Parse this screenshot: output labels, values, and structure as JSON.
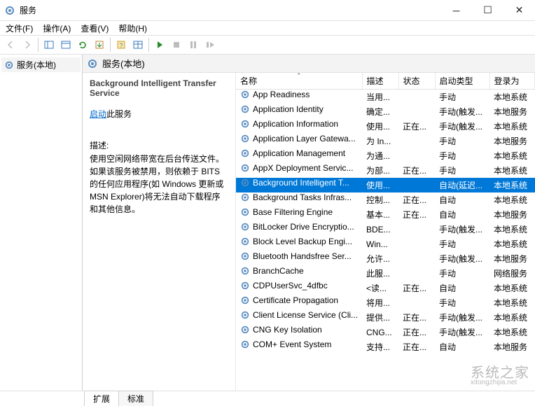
{
  "window": {
    "title": "服务"
  },
  "menubar": [
    "文件(F)",
    "操作(A)",
    "查看(V)",
    "帮助(H)"
  ],
  "tree": {
    "root": "服务(本地)"
  },
  "crumb": "服务(本地)",
  "detail": {
    "service_name": "Background Intelligent Transfer Service",
    "action_link": "启动",
    "action_suffix": "此服务",
    "desc_label": "描述:",
    "desc_text": "使用空闲网络带宽在后台传送文件。如果该服务被禁用，则依赖于 BITS 的任何应用程序(如 Windows 更新或 MSN Explorer)将无法自动下载程序和其他信息。"
  },
  "columns": {
    "name": "名称",
    "desc": "描述",
    "status": "状态",
    "startup": "启动类型",
    "logon": "登录为"
  },
  "services": [
    {
      "name": "App Readiness",
      "desc": "当用...",
      "status": "",
      "startup": "手动",
      "logon": "本地系统"
    },
    {
      "name": "Application Identity",
      "desc": "确定...",
      "status": "",
      "startup": "手动(触发...",
      "logon": "本地服务"
    },
    {
      "name": "Application Information",
      "desc": "使用...",
      "status": "正在...",
      "startup": "手动(触发...",
      "logon": "本地系统"
    },
    {
      "name": "Application Layer Gatewa...",
      "desc": "为 In...",
      "status": "",
      "startup": "手动",
      "logon": "本地服务"
    },
    {
      "name": "Application Management",
      "desc": "为通...",
      "status": "",
      "startup": "手动",
      "logon": "本地系统"
    },
    {
      "name": "AppX Deployment Servic...",
      "desc": "为部...",
      "status": "正在...",
      "startup": "手动",
      "logon": "本地系统"
    },
    {
      "name": "Background Intelligent T...",
      "desc": "使用...",
      "status": "",
      "startup": "自动(延迟...",
      "logon": "本地系统",
      "selected": true
    },
    {
      "name": "Background Tasks Infras...",
      "desc": "控制...",
      "status": "正在...",
      "startup": "自动",
      "logon": "本地系统"
    },
    {
      "name": "Base Filtering Engine",
      "desc": "基本...",
      "status": "正在...",
      "startup": "自动",
      "logon": "本地服务"
    },
    {
      "name": "BitLocker Drive Encryptio...",
      "desc": "BDE...",
      "status": "",
      "startup": "手动(触发...",
      "logon": "本地系统"
    },
    {
      "name": "Block Level Backup Engi...",
      "desc": "Win...",
      "status": "",
      "startup": "手动",
      "logon": "本地系统"
    },
    {
      "name": "Bluetooth Handsfree Ser...",
      "desc": "允许...",
      "status": "",
      "startup": "手动(触发...",
      "logon": "本地服务"
    },
    {
      "name": "BranchCache",
      "desc": "此服...",
      "status": "",
      "startup": "手动",
      "logon": "网络服务"
    },
    {
      "name": "CDPUserSvc_4dfbc",
      "desc": "<读...",
      "status": "正在...",
      "startup": "自动",
      "logon": "本地系统"
    },
    {
      "name": "Certificate Propagation",
      "desc": "将用...",
      "status": "",
      "startup": "手动",
      "logon": "本地系统"
    },
    {
      "name": "Client License Service (Cli...",
      "desc": "提供...",
      "status": "正在...",
      "startup": "手动(触发...",
      "logon": "本地系统"
    },
    {
      "name": "CNG Key Isolation",
      "desc": "CNG...",
      "status": "正在...",
      "startup": "手动(触发...",
      "logon": "本地系统"
    },
    {
      "name": "COM+ Event System",
      "desc": "支持...",
      "status": "正在...",
      "startup": "自动",
      "logon": "本地服务"
    }
  ],
  "tabs": {
    "extended": "扩展",
    "standard": "标准"
  },
  "watermark": {
    "main": "系统之家",
    "sub": "xitongzhijia.net"
  }
}
